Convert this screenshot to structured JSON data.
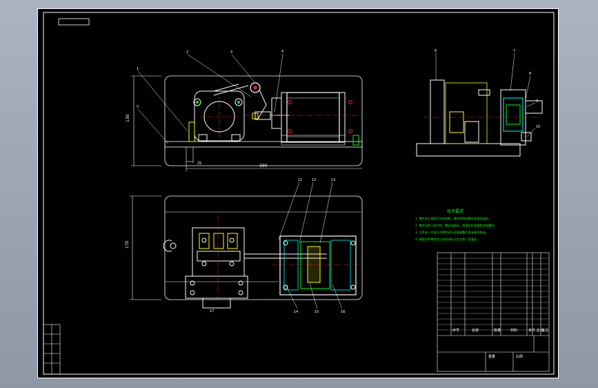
{
  "dims": {
    "height_front": "130",
    "length_front": "330",
    "height_top": "170",
    "small_dim": "25"
  },
  "balloons": [
    "1",
    "2",
    "3",
    "4",
    "5",
    "6",
    "7",
    "8",
    "9",
    "10",
    "11",
    "12",
    "13",
    "14",
    "15",
    "16",
    "17"
  ],
  "notes": {
    "title": "技术要求",
    "lines": [
      "1. 零件加工表面不应有划痕、擦伤等损伤零件表面的缺陷。",
      "2. 零件及装于组件时，螺纹连接处，加装防松垫圈和并紧螺母。",
      "3. 工件进一步液压润滑剂进行必要调整后再安装进机床。",
      "4. 装配好的零部件上的各项标注应达到一定要求。"
    ]
  },
  "title_block": {
    "header": [
      "序号",
      "名称",
      "数量",
      "材料",
      "单件 总计",
      "备注"
    ],
    "label_weight": "重量",
    "label_scale": "比例"
  },
  "side_strip": [
    "",
    "",
    "",
    "",
    ""
  ],
  "colors": {
    "line": "#ffffff",
    "green": "#00ff00",
    "yellow": "#ffff00",
    "cyan": "#00ffff",
    "red": "#ff2020",
    "blue": "#4060ff"
  }
}
